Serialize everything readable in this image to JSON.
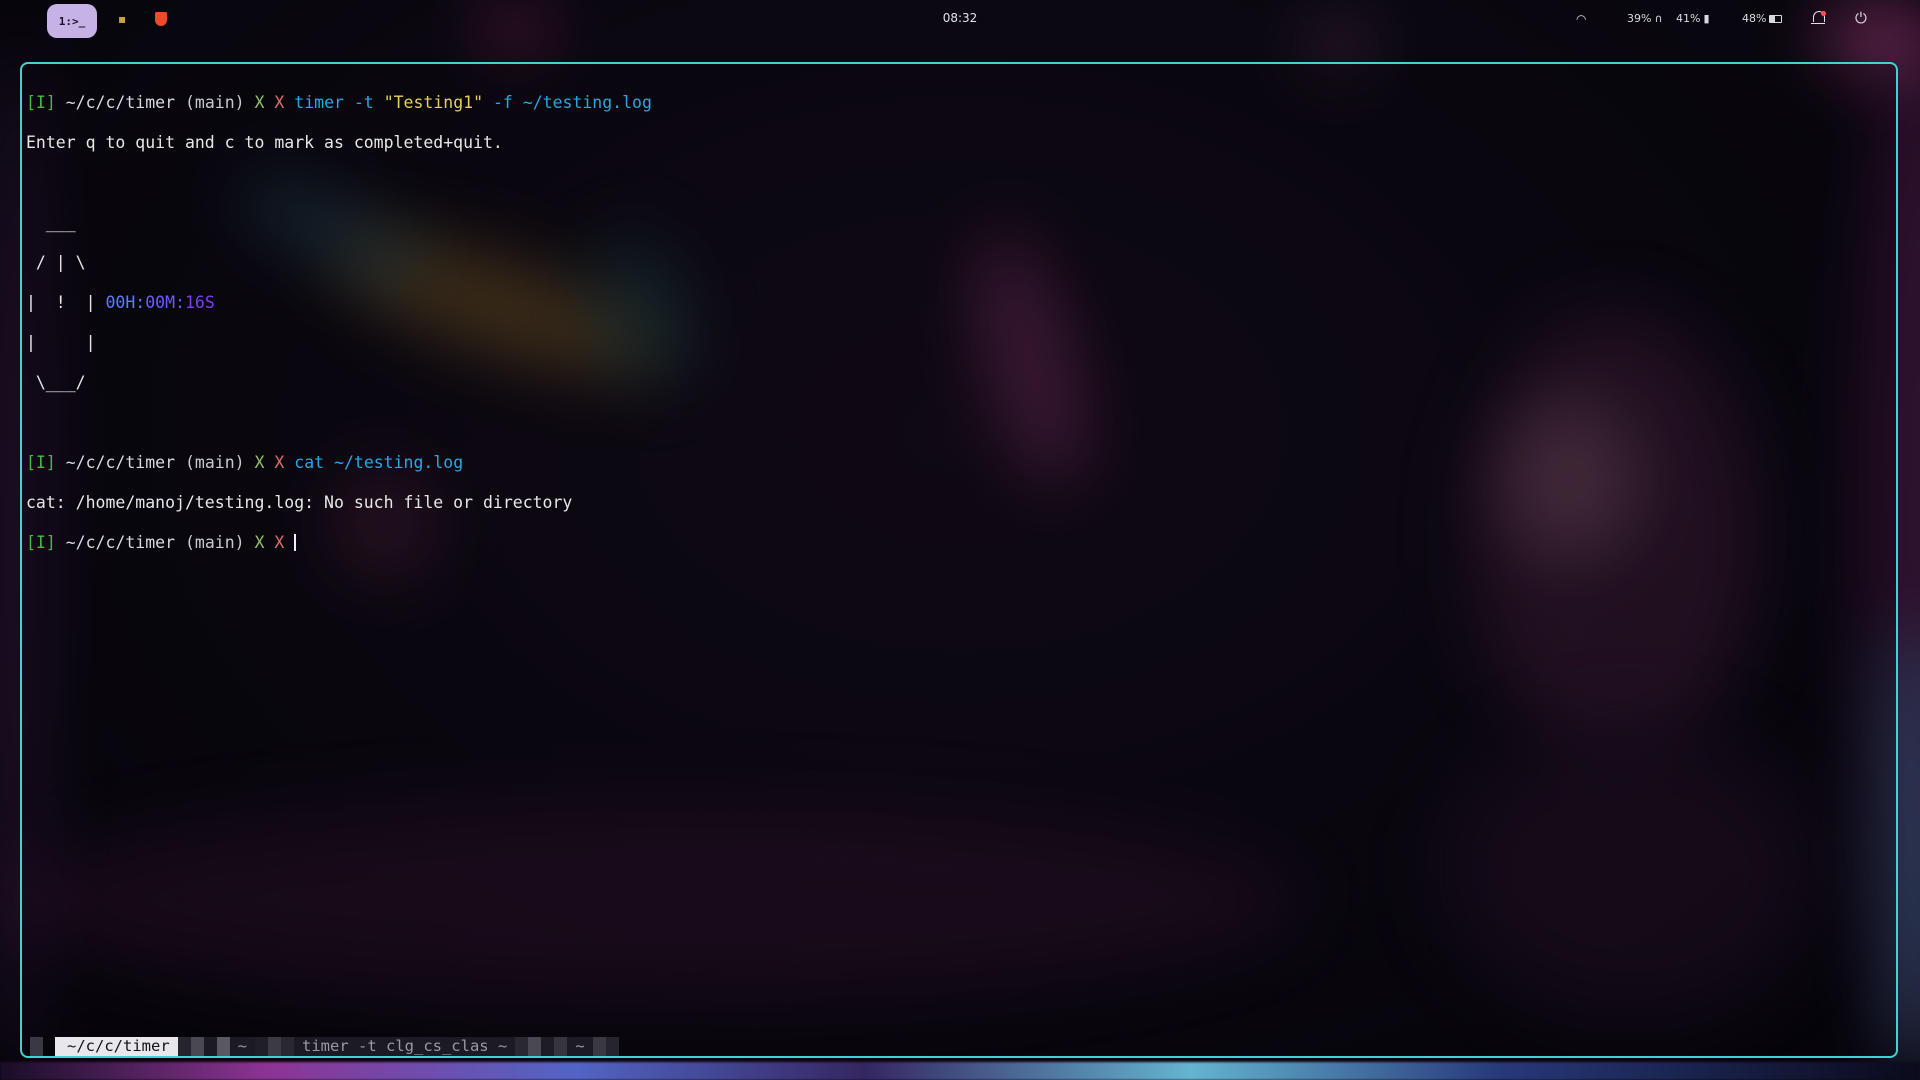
{
  "topbar": {
    "workspace_label": "1:>_",
    "clock": "08:32",
    "volume": "39%",
    "mic": "41%",
    "battery": "48%",
    "icons": [
      "wifi-icon",
      "headphones-icon",
      "mic-icon",
      "battery-icon",
      "bell-icon",
      "power-icon"
    ]
  },
  "terminal": {
    "prompt_tag": "[I]",
    "prompt_path": "~/c/c/timer",
    "prompt_branch": "(main)",
    "prompt_x1": "X",
    "prompt_x2": "X",
    "cmd1_name": "timer",
    "cmd1_flag1": "-t",
    "cmd1_str": "\"Testing1\"",
    "cmd1_flag2": "-f ~/testing.log",
    "info_line": "Enter q to quit and c to mark as completed+quit.",
    "art1": "  ___",
    "art2": " / | \\",
    "art3": "|  !  |",
    "art4": "|     |",
    "art5": " \\___/",
    "timer_h": "00H:",
    "timer_m": "00M:",
    "timer_s": "16S",
    "cmd2_name": "cat",
    "cmd2_arg": "~/testing.log",
    "error_line": "cat: /home/manoj/testing.log: No such file or directory"
  },
  "tmux": {
    "window1": "~/c/c/timer",
    "window2": "~",
    "window3": "timer -t clg_cs_clas ~",
    "window4": "~"
  },
  "colors": {
    "border": "#3fd3d3",
    "prompt_green": "#3fbf3f",
    "command_blue": "#2aa6e0",
    "string_yellow": "#e6cf5a",
    "timer_purple": "#7a3ff0"
  }
}
